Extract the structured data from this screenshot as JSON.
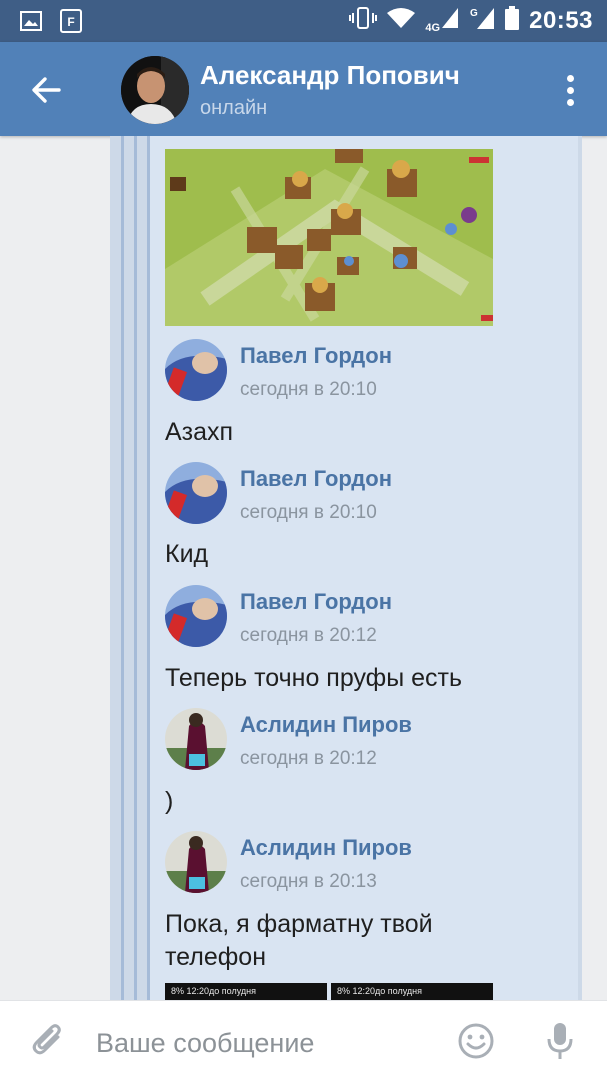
{
  "status_bar": {
    "time": "20:53",
    "network": "4G",
    "left_icons": [
      "image-icon",
      "flipboard-icon"
    ],
    "right_icons": [
      "vibrate-icon",
      "wifi-icon",
      "signal-icon",
      "signal-g-icon",
      "battery-icon"
    ]
  },
  "header": {
    "back_icon": "arrow-left-icon",
    "name": "Александр Попович",
    "status": "онлайн",
    "menu_icon": "more-vertical-icon"
  },
  "messages": [
    {
      "author": "Павел Гордон",
      "time": "сегодня в 20:10",
      "text": "Азахп"
    },
    {
      "author": "Павел Гордон",
      "time": "сегодня в 20:10",
      "text": "Кид"
    },
    {
      "author": "Павел Гордон",
      "time": "сегодня в 20:12",
      "text": "Теперь точно пруфы есть"
    },
    {
      "author": "Аслидин Пиров",
      "time": "сегодня в 20:12",
      "text": ")"
    },
    {
      "author": "Аслидин Пиров",
      "time": "сегодня в 20:13",
      "text": "Пока, я фарматну твой телефон"
    }
  ],
  "screenshots": [
    {
      "status": "8% 12:20до полудня"
    },
    {
      "status": "8% 12:20до полудня"
    }
  ],
  "input_bar": {
    "placeholder": "Ваше сообщение",
    "attach_icon": "paperclip-icon",
    "emoji_icon": "smile-icon",
    "mic_icon": "microphone-icon"
  },
  "colors": {
    "status_bar": "#3f5e86",
    "header": "#5181b8",
    "author_name": "#4a74a5",
    "bubble": "#d9e4f2"
  }
}
